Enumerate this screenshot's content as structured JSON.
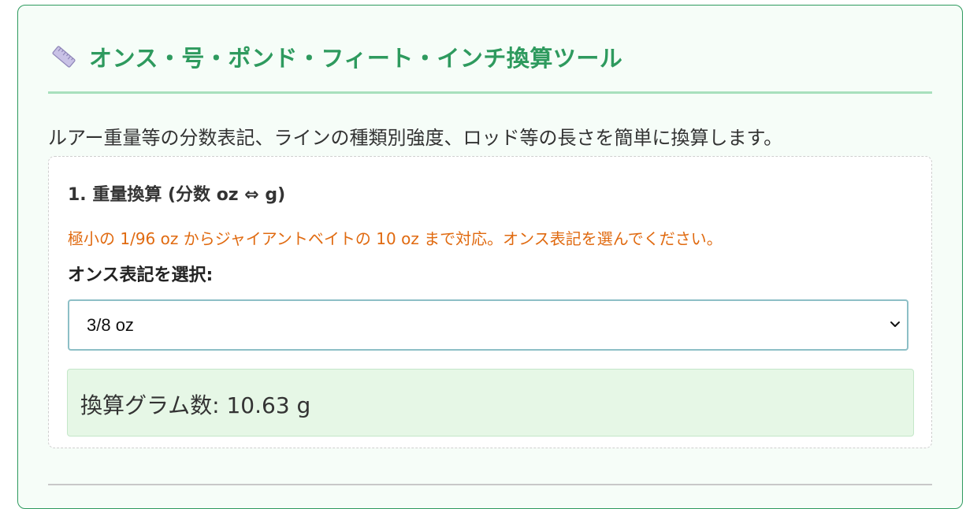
{
  "header": {
    "icon": "ruler-icon",
    "title": "オンス・号・ポンド・フィート・インチ換算ツール"
  },
  "intro": "ルアー重量等の分数表記、ラインの種類別強度、ロッド等の長さを簡単に換算します。",
  "weight_section": {
    "title": "1. 重量換算 (分数 oz ⇔ g)",
    "note": "極小の 1/96 oz からジャイアントベイトの 10 oz まで対応。オンス表記を選んでください。",
    "select_label": "オンス表記を選択:",
    "select_value": "3/8 oz",
    "result_text": "換算グラム数: 10.63 g"
  },
  "colors": {
    "accent": "#2e9a5e",
    "note": "#e06a10",
    "result_bg": "#e6f7e6"
  }
}
